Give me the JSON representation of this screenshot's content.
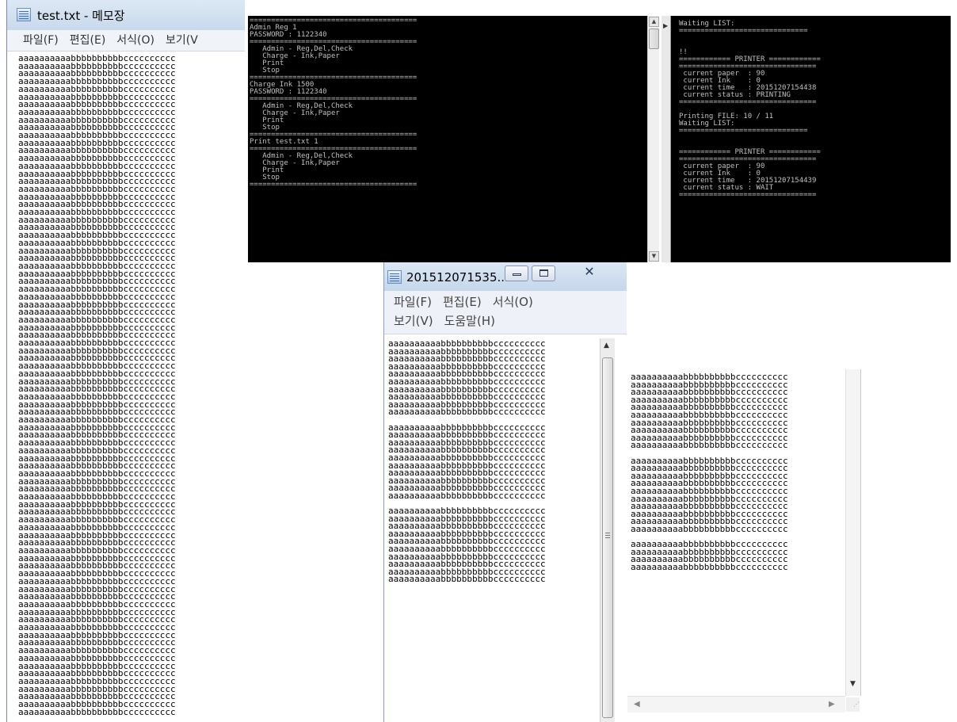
{
  "notepad1": {
    "title": "test.txt - 메모장",
    "menu": [
      "파일(F)",
      "편집(E)",
      "서식(O)",
      "보기(V"
    ],
    "line_text": "aaaaaaaaaabbbbbbbbbbcccccccccc",
    "line_count": 86
  },
  "console_left": {
    "lines": [
      "=======================================",
      "Admin Reg 1",
      "PASSWORD : 1122340",
      "=======================================",
      "   Admin - Reg,Del,Check",
      "   Charge - Ink,Paper",
      "   Print",
      "   Stop",
      "=======================================",
      "Charge Ink 1500",
      "PASSWORD : 1122340",
      "=======================================",
      "   Admin - Reg,Del,Check",
      "   Charge - Ink,Paper",
      "   Print",
      "   Stop",
      "=======================================",
      "Print test.txt 1",
      "=======================================",
      "   Admin - Reg,Del,Check",
      "   Charge - Ink,Paper",
      "   Print",
      "   Stop",
      "======================================="
    ]
  },
  "console_right": {
    "lines": [
      "Waiting LIST:",
      "==============================",
      "",
      "",
      "!!",
      "============ PRINTER ============",
      "================================",
      " current paper  : 90",
      " current Ink    : 0",
      " current time   : 20151207154438",
      " current status : PRINTING",
      "================================",
      "",
      "Printing FILE: 10 / 11",
      "Waiting LIST:",
      "==============================",
      "",
      "",
      "============ PRINTER ============",
      "================================",
      " current paper  : 90",
      " current Ink    : 0",
      " current time   : 20151207154439",
      " current status : WAIT",
      "================================"
    ]
  },
  "notepad2": {
    "title": "201512071535...",
    "menu_row1": [
      "파일(F)",
      "편집(E)",
      "서식(O)"
    ],
    "menu_row2": [
      "보기(V)",
      "도움말(H)"
    ],
    "line_text": "aaaaaaaaaabbbbbbbbbbcccccccccc",
    "blocks": [
      10,
      10,
      10
    ]
  },
  "notepad3": {
    "line_text": "aaaaaaaaaabbbbbbbbbbcccccccccc",
    "blocks": [
      10,
      10,
      4
    ]
  },
  "colors": {
    "title_bar": "#d7e4f2",
    "menu_bar": "#f0f3f8",
    "console_bg": "#000000",
    "console_text": "#c0c0c0"
  }
}
